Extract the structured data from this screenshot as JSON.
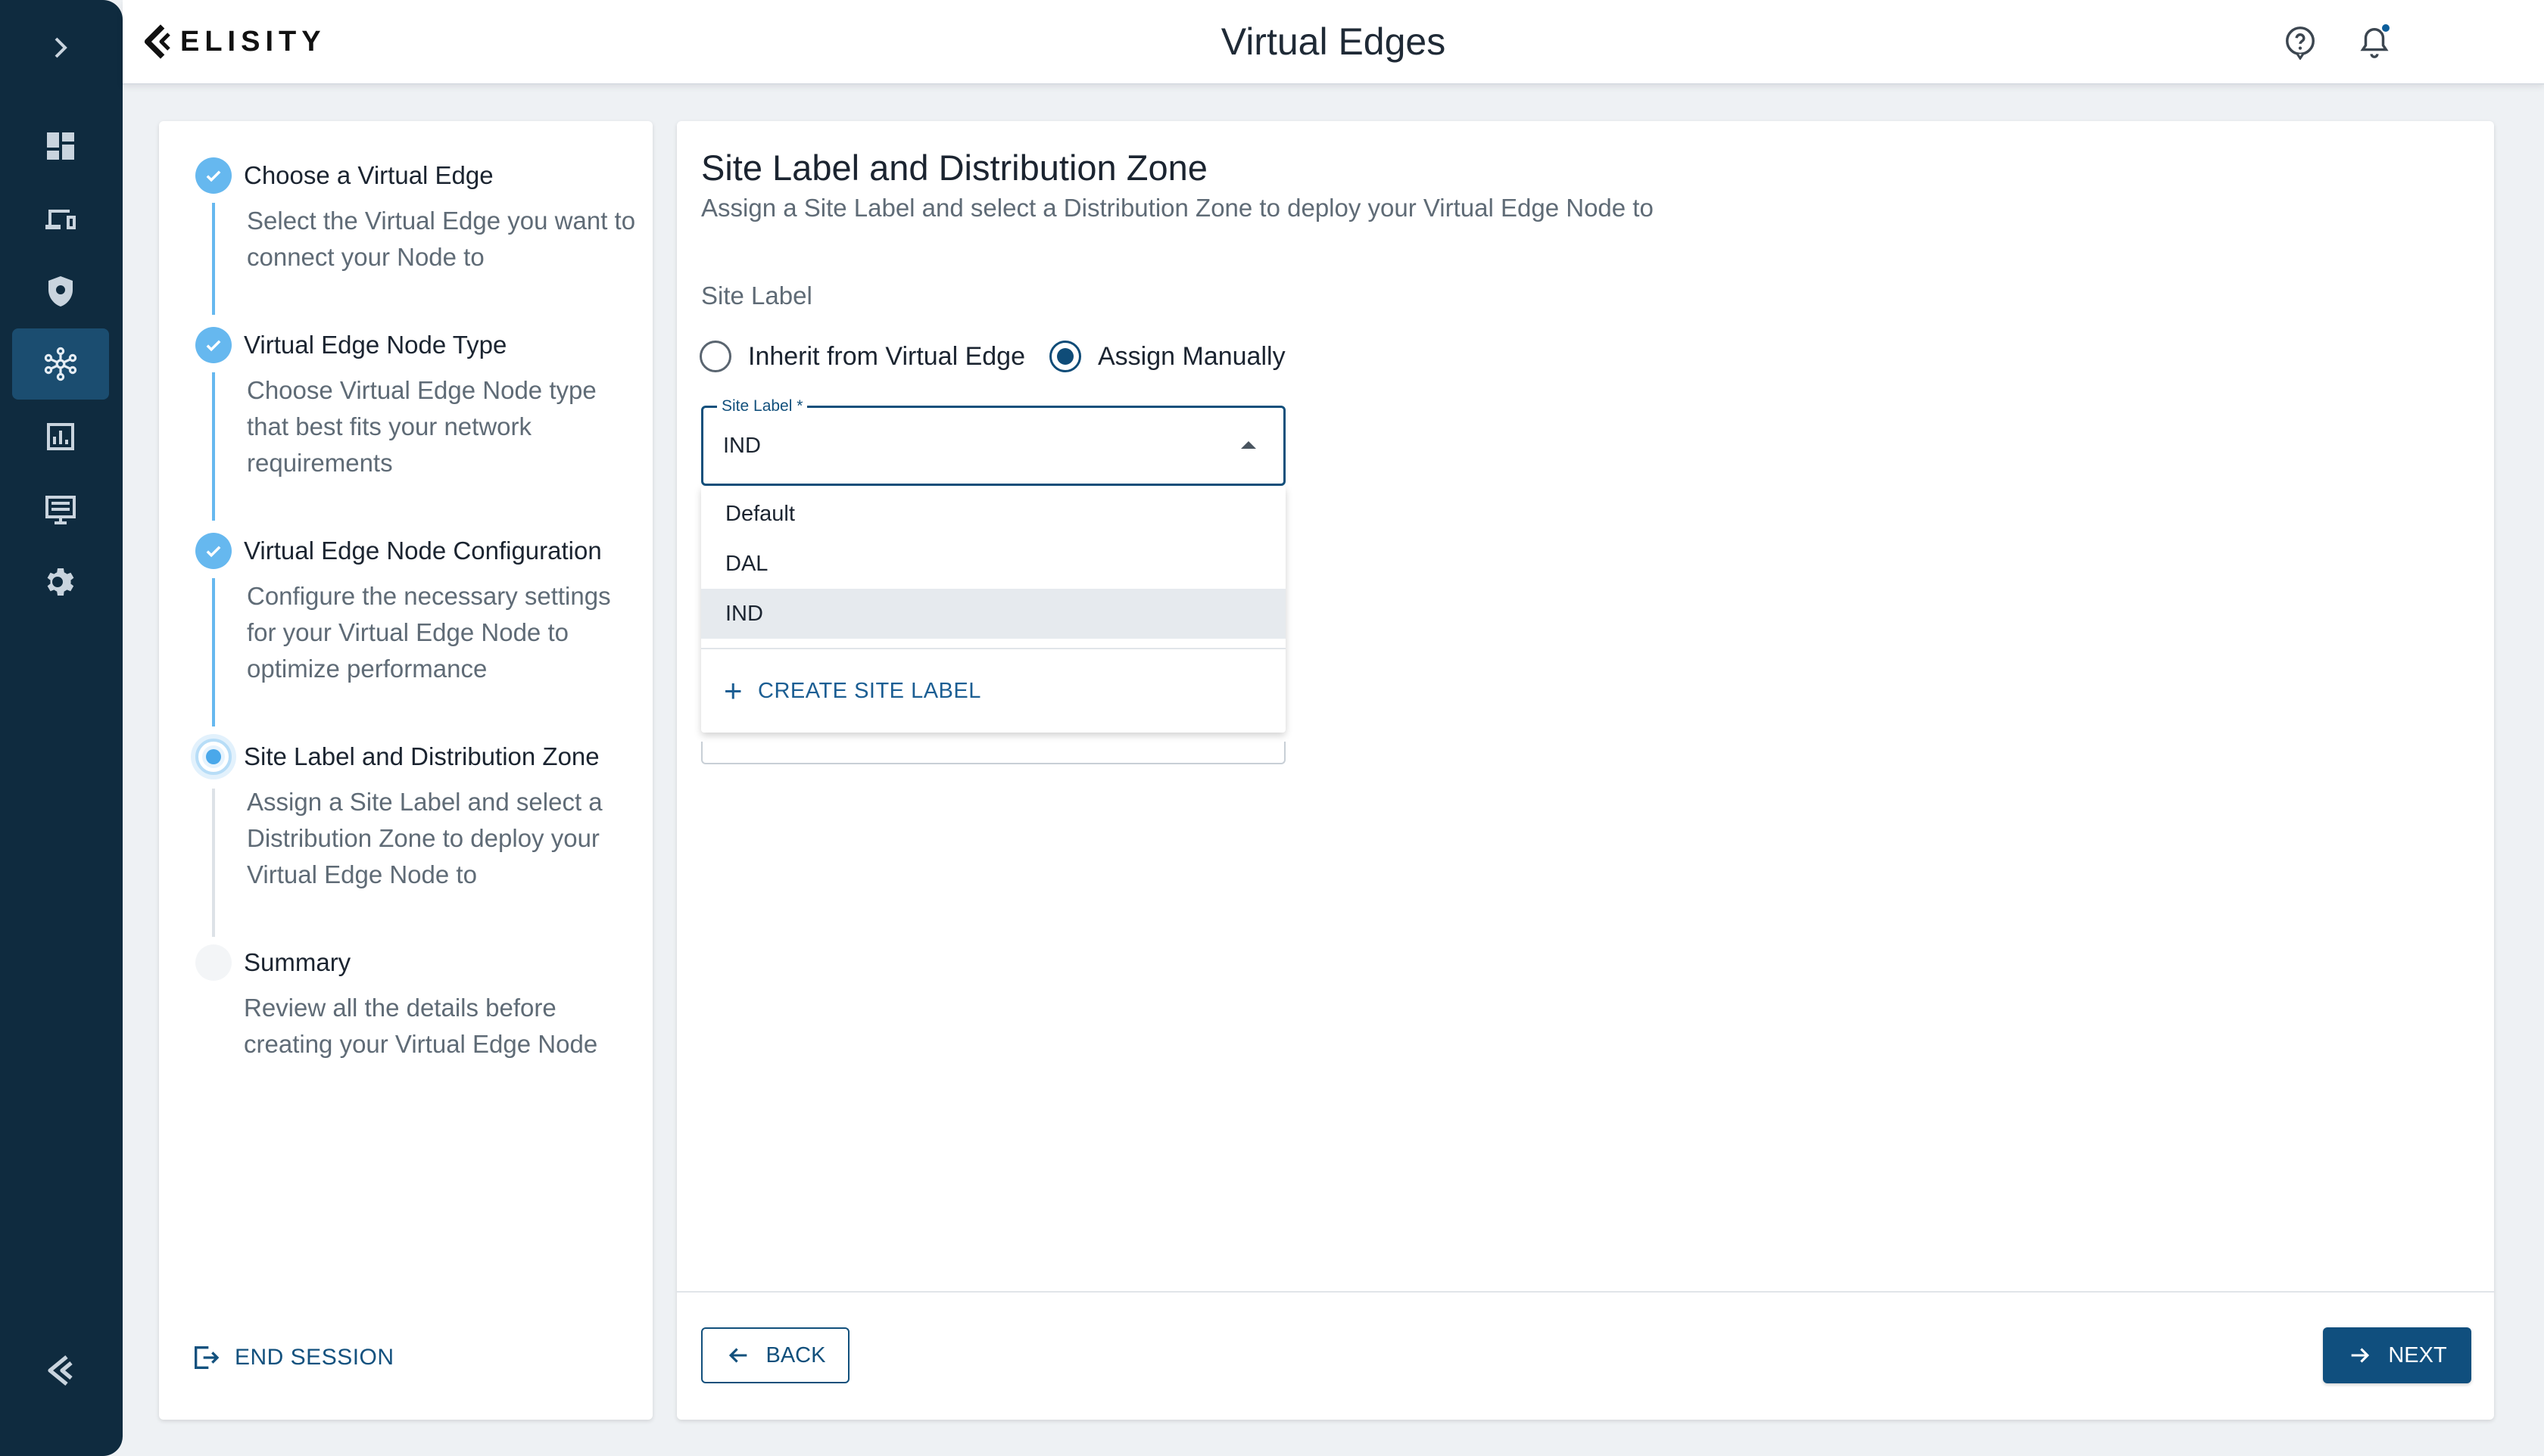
{
  "app": {
    "logo_text": "ELISITY",
    "page_title": "Virtual Edges"
  },
  "sidebar": {
    "items": [
      {
        "icon": "chevron-right-icon"
      },
      {
        "icon": "dashboard-icon"
      },
      {
        "icon": "devices-icon"
      },
      {
        "icon": "policy-shield-icon"
      },
      {
        "icon": "network-hub-icon",
        "active": true
      },
      {
        "icon": "analytics-icon"
      },
      {
        "icon": "logs-icon"
      },
      {
        "icon": "settings-icon"
      },
      {
        "icon": "elisity-logo-icon"
      }
    ]
  },
  "header": {
    "icons": [
      "help-icon",
      "bell-icon",
      "avatar-icon"
    ]
  },
  "stepper": {
    "steps": [
      {
        "title": "Choose a Virtual Edge",
        "description": "Select the Virtual Edge you want to connect your Node to",
        "state": "done"
      },
      {
        "title": "Virtual Edge Node Type",
        "description": "Choose Virtual Edge Node type that best fits your network requirements",
        "state": "done"
      },
      {
        "title": "Virtual Edge Node Configuration",
        "description": "Configure the necessary settings for your Virtual Edge Node to optimize performance",
        "state": "done"
      },
      {
        "title": "Site Label and Distribution Zone",
        "description": "Assign a Site Label and select a Distribution Zone to deploy your Virtual Edge Node to",
        "state": "current"
      },
      {
        "title": "Summary",
        "description": "Review all the details before creating your Virtual Edge Node",
        "state": "pending"
      }
    ],
    "end_session_label": "END SESSION"
  },
  "main": {
    "title": "Site Label and Distribution Zone",
    "subtitle": "Assign a Site Label and select a Distribution Zone to deploy your Virtual Edge Node to",
    "site_label_heading": "Site Label",
    "radio": {
      "option_inherit": "Inherit from Virtual Edge",
      "option_manual": "Assign Manually",
      "selected": "Assign Manually"
    },
    "site_label_field": {
      "legend": "Site Label *",
      "value": "IND"
    },
    "dropdown": {
      "options": [
        "Default",
        "DAL",
        "IND"
      ],
      "selected": "IND",
      "create_label": "CREATE SITE LABEL"
    },
    "back_label": "BACK",
    "next_label": "NEXT"
  }
}
